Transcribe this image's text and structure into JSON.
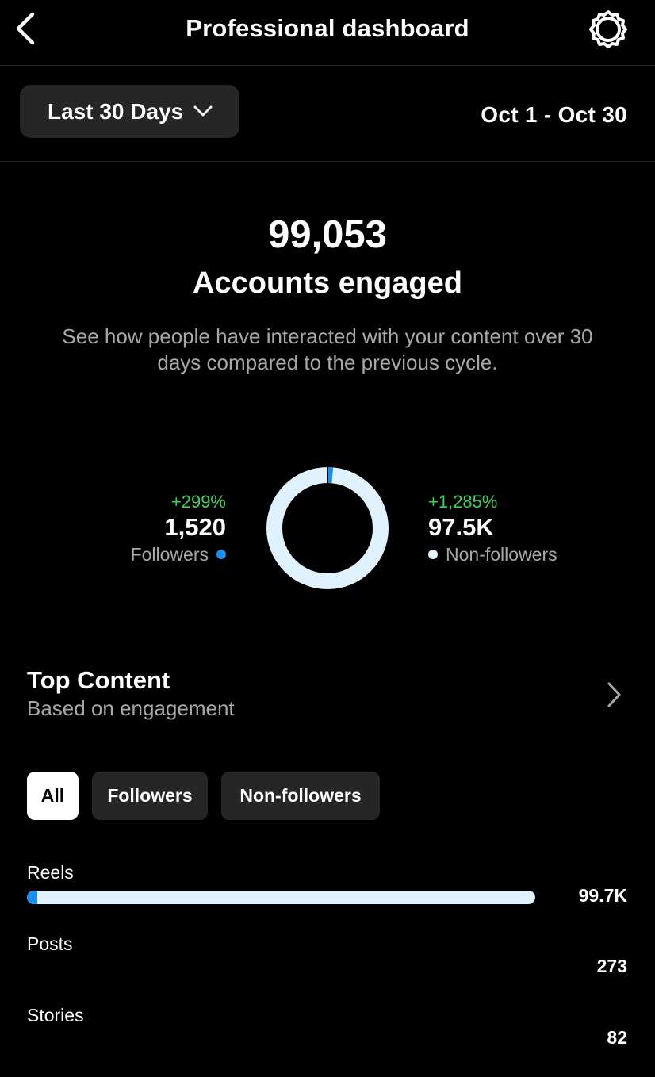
{
  "header": {
    "title": "Professional dashboard",
    "back_icon": "chevron-left-icon",
    "settings_icon": "gear-icon"
  },
  "filter": {
    "range_label": "Last 30 Days",
    "dropdown_icon": "chevron-down-icon",
    "date_range": "Oct 1 - Oct 30"
  },
  "summary": {
    "value": "99,053",
    "label": "Accounts engaged",
    "description": "See how people have interacted with your content over 30 days compared to the previous cycle."
  },
  "breakdown": {
    "followers": {
      "change": "+299%",
      "value": "1,520",
      "label": "Followers",
      "color": "#1d8fea"
    },
    "non_followers": {
      "change": "+1,285%",
      "value": "97.5K",
      "label": "Non-followers",
      "color": "#e0f1ff"
    },
    "followers_fraction": 0.015
  },
  "top_content": {
    "title": "Top Content",
    "subtitle": "Based on engagement",
    "chevron_icon": "chevron-right-icon"
  },
  "tabs": [
    {
      "label": "All",
      "selected": true
    },
    {
      "label": "Followers",
      "selected": false
    },
    {
      "label": "Non-followers",
      "selected": false
    }
  ],
  "content_types": [
    {
      "label": "Reels",
      "value": "99.7K",
      "follower_fraction": 0.02
    },
    {
      "label": "Posts",
      "value": "273"
    },
    {
      "label": "Stories",
      "value": "82"
    }
  ],
  "colors": {
    "accent_blue": "#1d8fea",
    "light_blue": "#e0f1ff",
    "positive_green": "#3ecf5b",
    "chip_bg": "#262626"
  }
}
